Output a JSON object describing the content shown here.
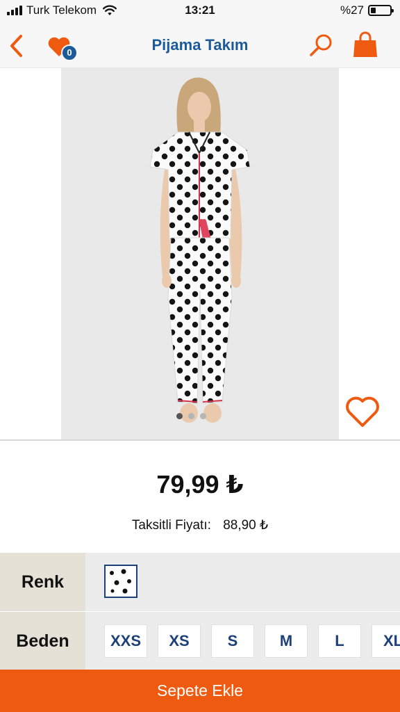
{
  "status_bar": {
    "carrier": "Turk Telekom",
    "time": "13:21",
    "battery_text": "%27",
    "battery_level": 0.27,
    "signal_bars": 4
  },
  "navbar": {
    "title": "Pijama Takım",
    "favorites_count": "0",
    "accent_color": "#ee5a0f",
    "title_color": "#1d5a9a"
  },
  "gallery": {
    "image_count": 3,
    "active_index": 0,
    "is_favorite": false
  },
  "product": {
    "price": "79,99 ₺",
    "installment_label": "Taksitli Fiyatı:",
    "installment_price": "88,90 ₺"
  },
  "options": {
    "color_label": "Renk",
    "colors": [
      {
        "name": "polka-dot-white-black"
      }
    ],
    "size_label": "Beden",
    "sizes": [
      "XXS",
      "XS",
      "S",
      "M",
      "L",
      "XL"
    ]
  },
  "cta": {
    "add_to_cart": "Sepete Ekle",
    "color": "#ee5a0f"
  }
}
